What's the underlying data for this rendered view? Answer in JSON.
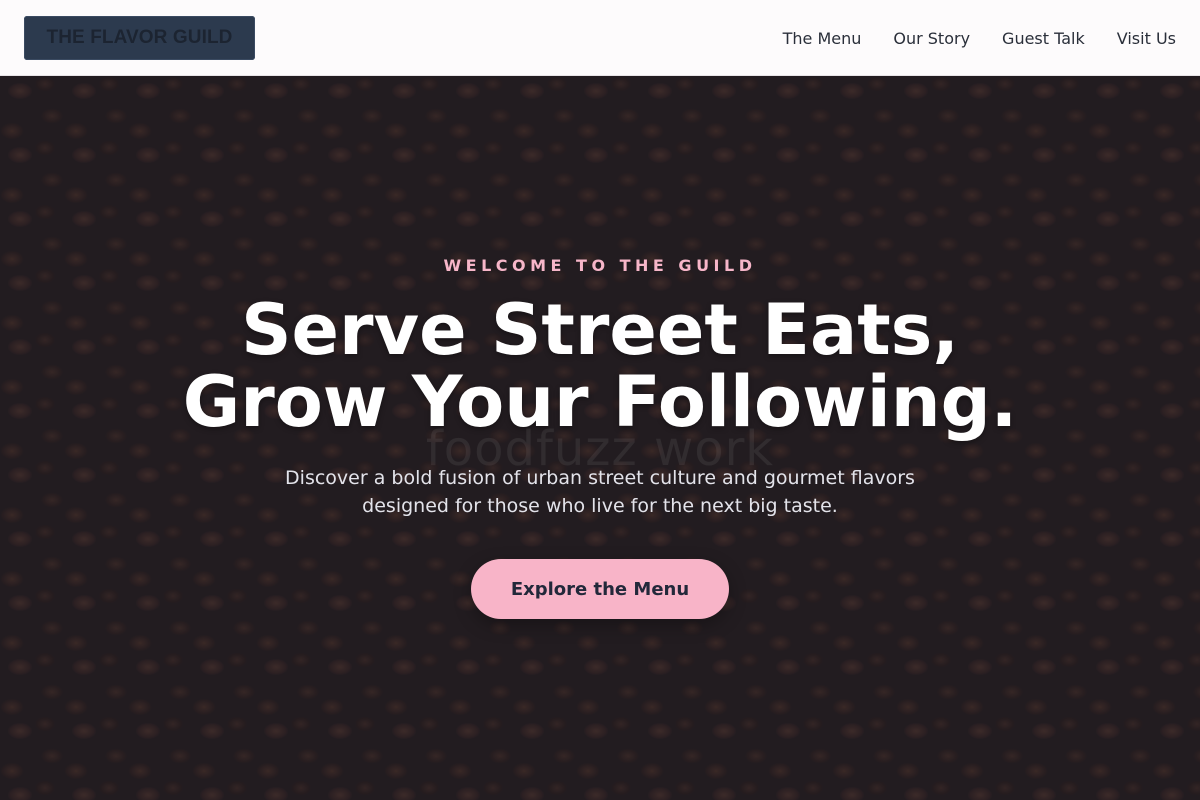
{
  "header": {
    "logo_text": "THE FLAVOR GUILD",
    "nav": [
      {
        "label": "The Menu"
      },
      {
        "label": "Our Story"
      },
      {
        "label": "Guest Talk"
      },
      {
        "label": "Visit Us"
      }
    ]
  },
  "hero": {
    "eyebrow": "WELCOME TO THE GUILD",
    "headline_line1": "Serve Street Eats,",
    "headline_line2": "Grow Your Following.",
    "watermark": "foodfuzz work",
    "subtitle_line1": "Discover a bold fusion of urban street culture and gourmet flavors",
    "subtitle_line2": "designed for those who live for the next big taste.",
    "cta_label": "Explore the Menu",
    "background_image": "coffee-beans-photo"
  },
  "colors": {
    "accent_pink": "#f8b4c8",
    "logo_bg": "#2c3a4e",
    "header_bg": "#fdfbfc",
    "overlay": "#181826"
  }
}
